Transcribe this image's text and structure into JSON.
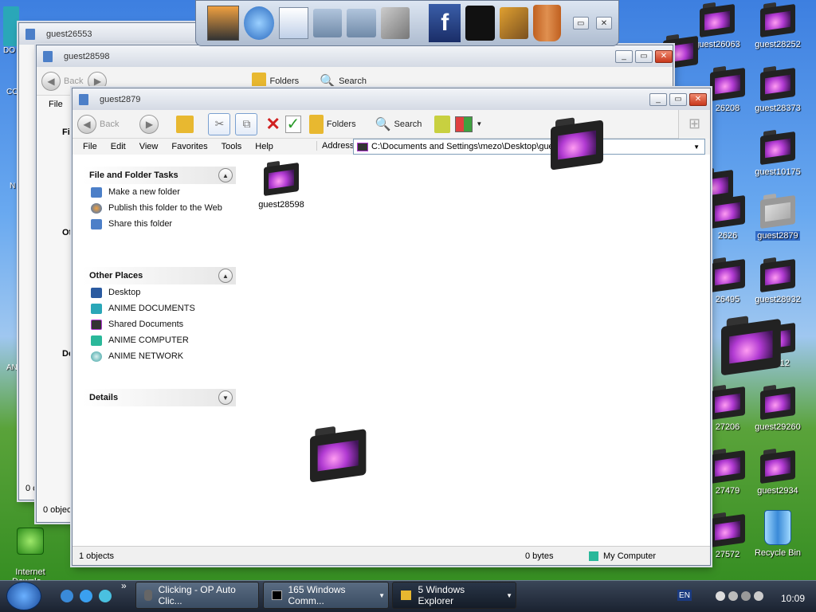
{
  "desktop": {
    "right_col1": [
      {
        "label": "guest26063"
      },
      {
        "label": "26208"
      },
      {
        "label": "2626"
      },
      {
        "label": "26495"
      },
      {
        "label": "27206"
      },
      {
        "label": "27479"
      },
      {
        "label": "27572"
      }
    ],
    "right_col2": [
      {
        "label": "guest28252"
      },
      {
        "label": "guest28373"
      },
      {
        "label": "guest10175"
      },
      {
        "label": "guest2879"
      },
      {
        "label": "guest28932"
      },
      {
        "label": "29112"
      },
      {
        "label": "guest29260"
      },
      {
        "label": "guest2934"
      },
      {
        "label": "Recycle Bin"
      }
    ],
    "left_labels": {
      "do": "DO",
      "co": "CO",
      "n": "N",
      "an": "AN"
    },
    "internet_download": "Internet\nDownlo..."
  },
  "dock": {
    "icons": [
      "naruto-avatar",
      "globe",
      "documents",
      "folder",
      "folder-music",
      "tools",
      "facebook",
      "tshirt",
      "hammer",
      "bucket"
    ]
  },
  "win_back": {
    "title": "guest26553"
  },
  "win_mid": {
    "title": "guest28598",
    "back_label": "Back",
    "folders_label": "Folders",
    "search_label": "Search",
    "menu_file": "File",
    "partial_fi": "Fi",
    "partial_ot": "Ot",
    "partial_de": "De",
    "status_objects": "0 objec",
    "status_back": "0 c"
  },
  "win_front": {
    "title": "guest2879",
    "back_label": "Back",
    "folders_label": "Folders",
    "search_label": "Search",
    "menu": [
      "File",
      "Edit",
      "View",
      "Favorites",
      "Tools",
      "Help"
    ],
    "address_label": "Address",
    "address_value": "C:\\Documents and Settings\\mezo\\Desktop\\gues",
    "tasks": {
      "heading": "File and Folder Tasks",
      "items": [
        "Make a new folder",
        "Publish this folder to the Web",
        "Share this folder"
      ]
    },
    "places": {
      "heading": "Other Places",
      "items": [
        "Desktop",
        "ANIME DOCUMENTS",
        "Shared Documents",
        "ANIME COMPUTER",
        "ANIME NETWORK"
      ]
    },
    "details": {
      "heading": "Details"
    },
    "content_folder": "guest28598",
    "status": {
      "objects": "1 objects",
      "size": "0 bytes",
      "location": "My Computer"
    }
  },
  "taskbar": {
    "chevron": "»",
    "tasks": [
      {
        "label": "Clicking - OP Auto Clic..."
      },
      {
        "label": "165 Windows Comm..."
      },
      {
        "label": "5 Windows Explorer"
      }
    ],
    "lang": "EN",
    "clock": "10:09"
  },
  "colors": {
    "accent": "#4c7fc8",
    "purple": "#b13ad2"
  }
}
